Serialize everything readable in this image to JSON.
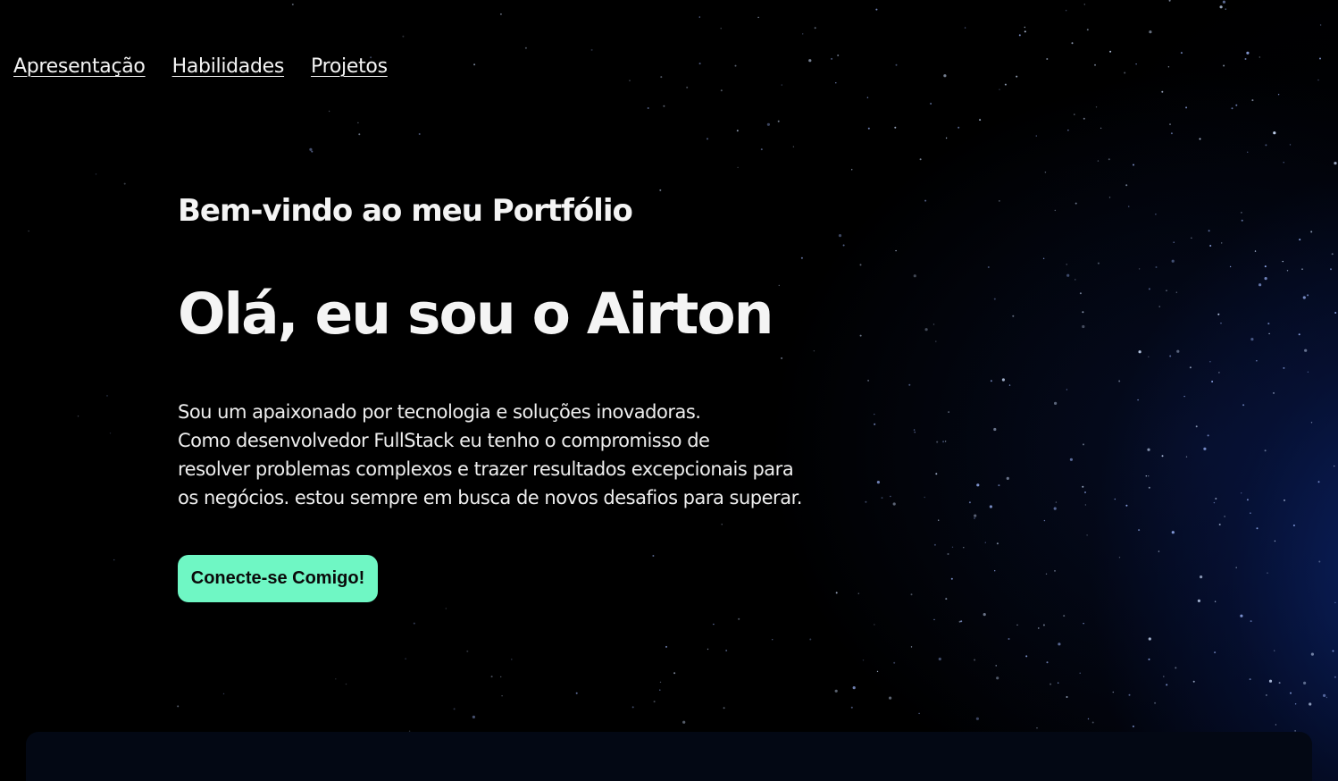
{
  "nav": {
    "items": [
      {
        "label": "Apresentação"
      },
      {
        "label": "Habilidades"
      },
      {
        "label": "Projetos"
      }
    ]
  },
  "hero": {
    "welcome": "Bem-vindo ao meu Portfólio",
    "name": "Olá, eu sou o Airton",
    "bio_lines": [
      "Sou um apaixonado por tecnologia e soluções inovadoras.",
      "Como desenvolvedor FullStack eu tenho o compromisso de",
      "resolver problemas complexos e trazer resultados excepcionais para",
      "os negócios. estou sempre em busca de novos desafios para superar."
    ],
    "cta_label": "Conecte-se Comigo!"
  },
  "colors": {
    "background": "#000000",
    "text": "#f4f4f4",
    "accent": "#6ff7c4",
    "panel": "#030814",
    "nebula": "#0c2878"
  }
}
